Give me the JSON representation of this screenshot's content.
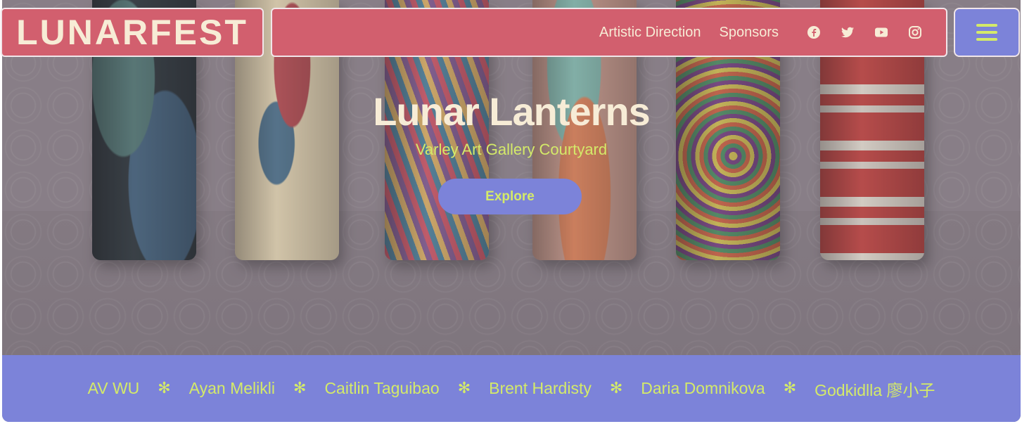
{
  "header": {
    "logo": "LUNARFEST",
    "nav": [
      "Artistic Direction",
      "Sponsors"
    ],
    "social_icons": [
      "facebook-icon",
      "twitter-icon",
      "youtube-icon",
      "instagram-icon"
    ],
    "menu_icon": "hamburger-menu-icon"
  },
  "hero": {
    "title": "Lunar Lanterns",
    "subtitle": "Varley Art Gallery Courtyard",
    "cta": "Explore"
  },
  "artists": {
    "names": [
      "AV WU",
      "Ayan Melikli",
      "Caitlin Taguibao",
      "Brent Hardisty",
      "Daria Domnikova",
      "Godkidlla 廖小子"
    ],
    "separator": "✻"
  },
  "colors": {
    "brand_pink": "#d25f6e",
    "accent_blue": "#7c83d9",
    "accent_lime": "#d4ea69",
    "cream": "#f7ecd6"
  }
}
